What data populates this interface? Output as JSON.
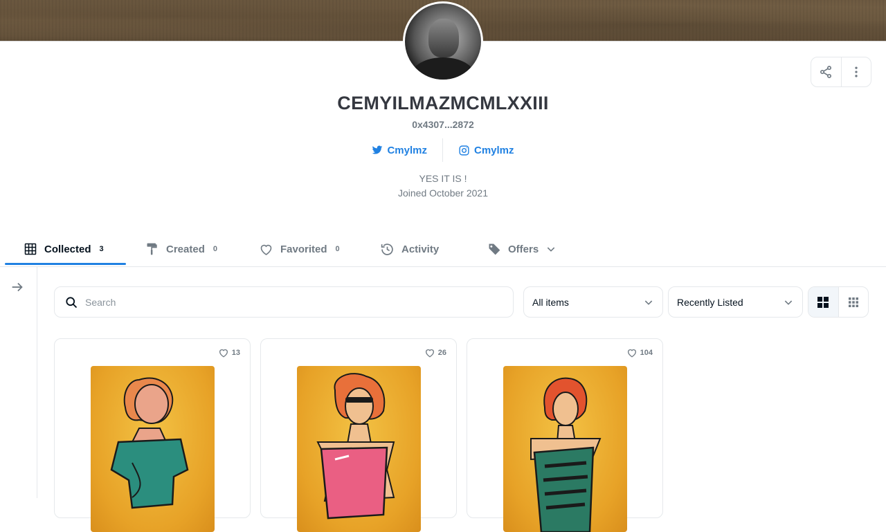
{
  "profile": {
    "username": "CEMYILMAZMCMLXXIII",
    "address": "0x4307...2872",
    "twitter": "Cmylmz",
    "instagram": "Cmylmz",
    "bio": "YES IT IS !",
    "joined": "Joined October 2021"
  },
  "tabs": [
    {
      "label": "Collected",
      "count": "3",
      "icon": "grid-icon",
      "active": true
    },
    {
      "label": "Created",
      "count": "0",
      "icon": "paint-roller-icon"
    },
    {
      "label": "Favorited",
      "count": "0",
      "icon": "heart-icon"
    },
    {
      "label": "Activity",
      "icon": "history-icon"
    },
    {
      "label": "Offers",
      "icon": "tag-icon"
    }
  ],
  "toolbar": {
    "search_placeholder": "Search",
    "filter_value": "All items",
    "sort_value": "Recently Listed"
  },
  "cards": [
    {
      "favorites": "13"
    },
    {
      "favorites": "26"
    },
    {
      "favorites": "104"
    }
  ],
  "colors": {
    "accent": "#2081e2",
    "text_primary": "#04111d",
    "text_secondary": "#707a83",
    "border": "#e5e8eb"
  }
}
